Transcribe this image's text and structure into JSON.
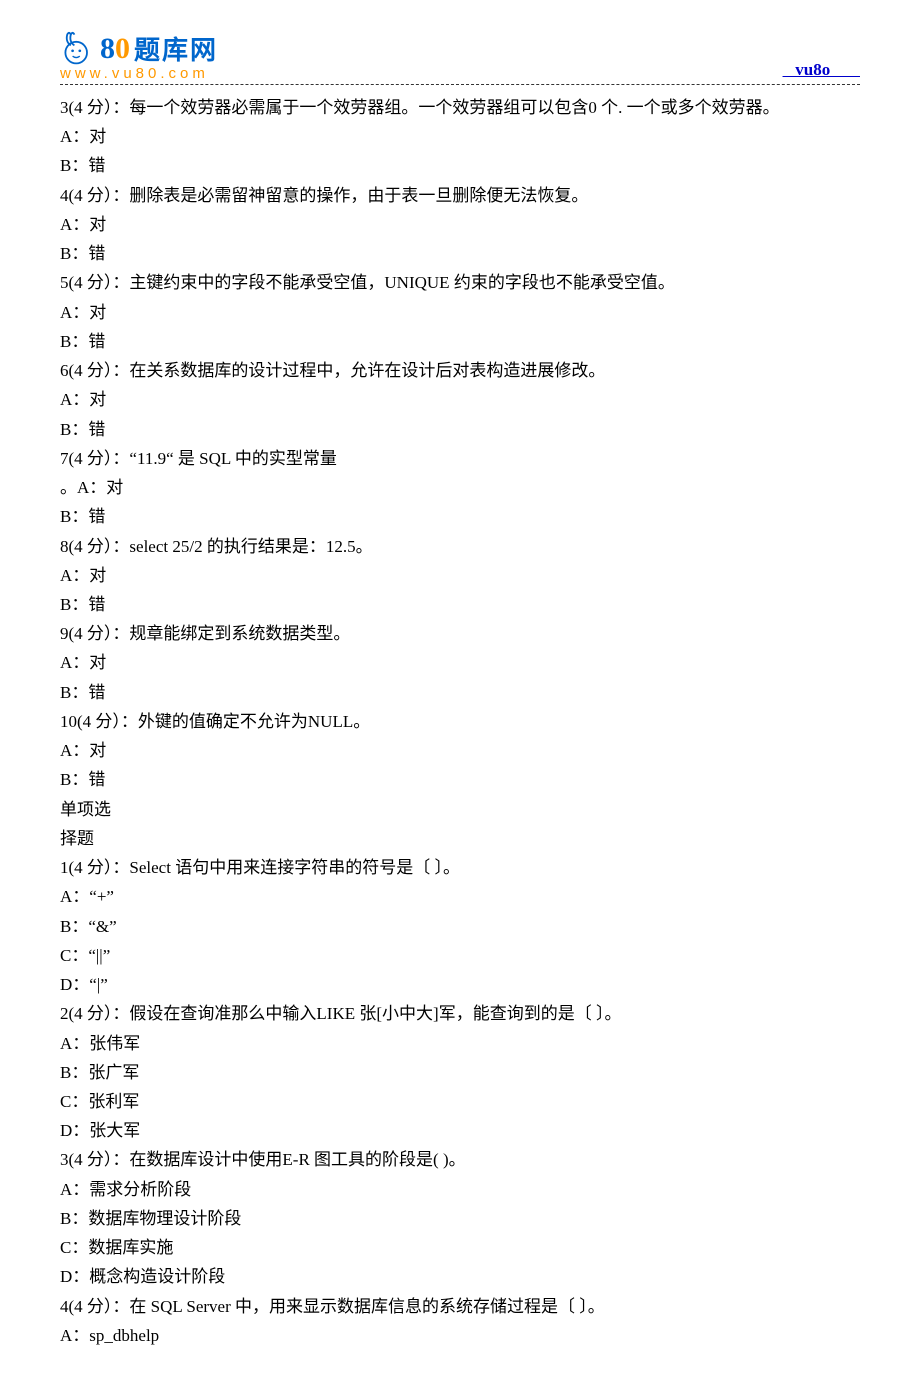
{
  "header": {
    "logo_cn": "题库网",
    "logo_url": "www.vu80.com",
    "link_text": "   vu8o       "
  },
  "lines": [
    "3(4 分）：每一个效劳器必需属于一个效劳器组。一个效劳器组可以包含0 个. 一个或多个效劳器。",
    "A：对",
    "B：错",
    "4(4 分）：删除表是必需留神留意的操作，由于表一旦删除便无法恢复。",
    "A：对",
    "B：错",
    "5(4 分）：主键约束中的字段不能承受空值，UNIQUE 约束的字段也不能承受空值。",
    "A：对",
    "B：错",
    "6(4 分）：在关系数据库的设计过程中，允许在设计后对表构造进展修改。",
    "A：对",
    "B：错",
    "7(4 分）：“11.9“ 是 SQL 中的实型常量",
    "。A：对",
    "B：错",
    "8(4 分）：select 25/2 的执行结果是：12.5。",
    "A：对",
    "B：错",
    "9(4 分）：规章能绑定到系统数据类型。",
    "A：对",
    "B：错",
    "10(4 分）：外键的值确定不允许为NULL。",
    "A：对",
    "B：错",
    "单项选",
    "择题",
    "1(4 分）：Select 语句中用来连接字符串的符号是〔    〕。",
    "A：“+”",
    "B：“&”",
    "C：“||”",
    "D：“|”",
    "2(4 分）：假设在查询准那么中输入LIKE 张[小中大]军，能查询到的是〔     〕。",
    "A：张伟军",
    "B：张广军",
    "C：张利军",
    "D：张大军",
    "3(4 分）：在数据库设计中使用E-R 图工具的阶段是(       )。",
    "A：需求分析阶段",
    "B：数据库物理设计阶段",
    "C：数据库实施",
    "D：概念构造设计阶段",
    "4(4 分）：在 SQL Server 中，用来显示数据库信息的系统存储过程是〔      〕。",
    "A：sp_dbhelp"
  ]
}
